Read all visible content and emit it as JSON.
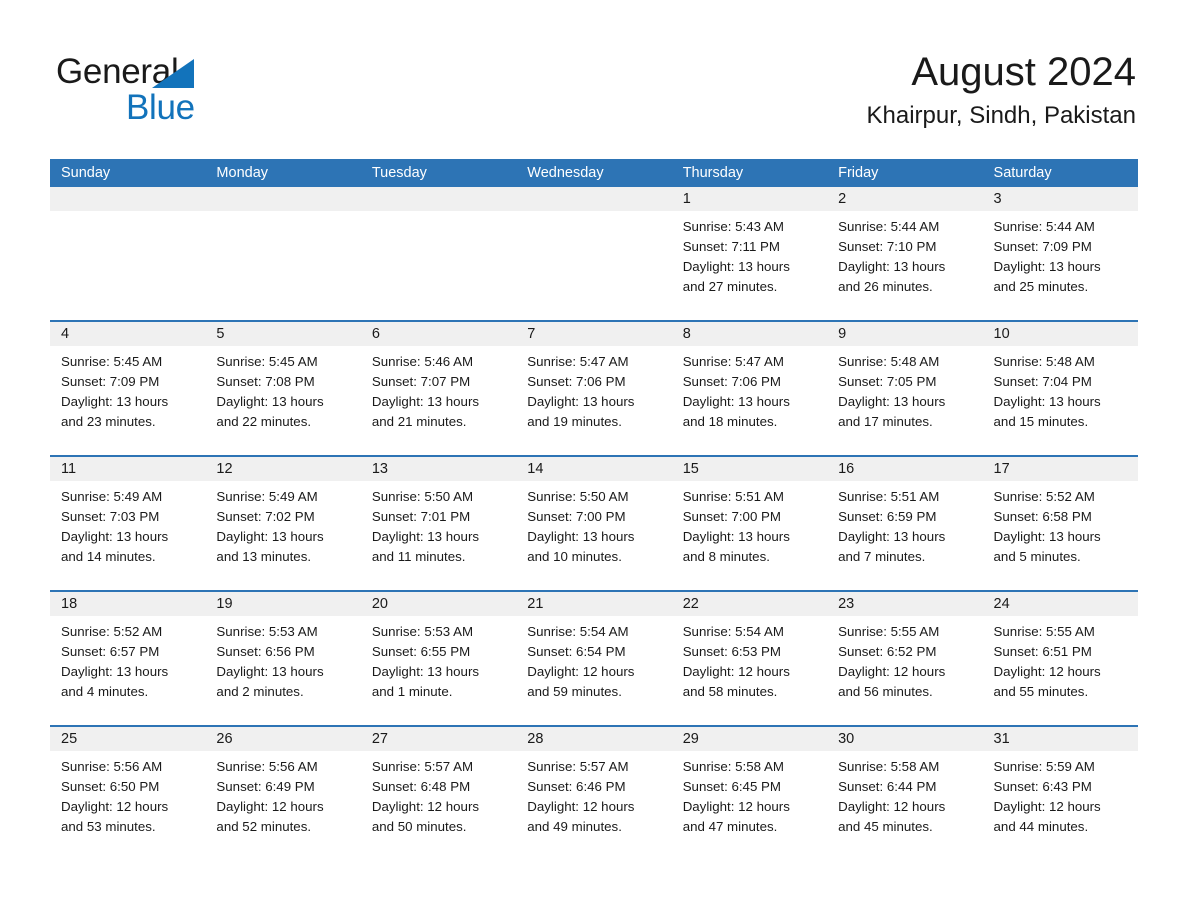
{
  "brand": {
    "name_part1": "General",
    "name_part2": "Blue",
    "logo_icon": "triangle-logo-icon",
    "colors": {
      "black": "#1a1a1a",
      "blue": "#1273bb"
    }
  },
  "header": {
    "title": "August 2024",
    "location": "Khairpur, Sindh, Pakistan"
  },
  "calendar": {
    "header_bg": "#2d74b5",
    "day_band_bg": "#f0f0f0",
    "weekdays": [
      "Sunday",
      "Monday",
      "Tuesday",
      "Wednesday",
      "Thursday",
      "Friday",
      "Saturday"
    ],
    "weeks": [
      [
        {
          "empty": true
        },
        {
          "empty": true
        },
        {
          "empty": true
        },
        {
          "empty": true
        },
        {
          "day": "1",
          "sunrise": "Sunrise: 5:43 AM",
          "sunset": "Sunset: 7:11 PM",
          "daylight_line1": "Daylight: 13 hours",
          "daylight_line2": "and 27 minutes."
        },
        {
          "day": "2",
          "sunrise": "Sunrise: 5:44 AM",
          "sunset": "Sunset: 7:10 PM",
          "daylight_line1": "Daylight: 13 hours",
          "daylight_line2": "and 26 minutes."
        },
        {
          "day": "3",
          "sunrise": "Sunrise: 5:44 AM",
          "sunset": "Sunset: 7:09 PM",
          "daylight_line1": "Daylight: 13 hours",
          "daylight_line2": "and 25 minutes."
        }
      ],
      [
        {
          "day": "4",
          "sunrise": "Sunrise: 5:45 AM",
          "sunset": "Sunset: 7:09 PM",
          "daylight_line1": "Daylight: 13 hours",
          "daylight_line2": "and 23 minutes."
        },
        {
          "day": "5",
          "sunrise": "Sunrise: 5:45 AM",
          "sunset": "Sunset: 7:08 PM",
          "daylight_line1": "Daylight: 13 hours",
          "daylight_line2": "and 22 minutes."
        },
        {
          "day": "6",
          "sunrise": "Sunrise: 5:46 AM",
          "sunset": "Sunset: 7:07 PM",
          "daylight_line1": "Daylight: 13 hours",
          "daylight_line2": "and 21 minutes."
        },
        {
          "day": "7",
          "sunrise": "Sunrise: 5:47 AM",
          "sunset": "Sunset: 7:06 PM",
          "daylight_line1": "Daylight: 13 hours",
          "daylight_line2": "and 19 minutes."
        },
        {
          "day": "8",
          "sunrise": "Sunrise: 5:47 AM",
          "sunset": "Sunset: 7:06 PM",
          "daylight_line1": "Daylight: 13 hours",
          "daylight_line2": "and 18 minutes."
        },
        {
          "day": "9",
          "sunrise": "Sunrise: 5:48 AM",
          "sunset": "Sunset: 7:05 PM",
          "daylight_line1": "Daylight: 13 hours",
          "daylight_line2": "and 17 minutes."
        },
        {
          "day": "10",
          "sunrise": "Sunrise: 5:48 AM",
          "sunset": "Sunset: 7:04 PM",
          "daylight_line1": "Daylight: 13 hours",
          "daylight_line2": "and 15 minutes."
        }
      ],
      [
        {
          "day": "11",
          "sunrise": "Sunrise: 5:49 AM",
          "sunset": "Sunset: 7:03 PM",
          "daylight_line1": "Daylight: 13 hours",
          "daylight_line2": "and 14 minutes."
        },
        {
          "day": "12",
          "sunrise": "Sunrise: 5:49 AM",
          "sunset": "Sunset: 7:02 PM",
          "daylight_line1": "Daylight: 13 hours",
          "daylight_line2": "and 13 minutes."
        },
        {
          "day": "13",
          "sunrise": "Sunrise: 5:50 AM",
          "sunset": "Sunset: 7:01 PM",
          "daylight_line1": "Daylight: 13 hours",
          "daylight_line2": "and 11 minutes."
        },
        {
          "day": "14",
          "sunrise": "Sunrise: 5:50 AM",
          "sunset": "Sunset: 7:00 PM",
          "daylight_line1": "Daylight: 13 hours",
          "daylight_line2": "and 10 minutes."
        },
        {
          "day": "15",
          "sunrise": "Sunrise: 5:51 AM",
          "sunset": "Sunset: 7:00 PM",
          "daylight_line1": "Daylight: 13 hours",
          "daylight_line2": "and 8 minutes."
        },
        {
          "day": "16",
          "sunrise": "Sunrise: 5:51 AM",
          "sunset": "Sunset: 6:59 PM",
          "daylight_line1": "Daylight: 13 hours",
          "daylight_line2": "and 7 minutes."
        },
        {
          "day": "17",
          "sunrise": "Sunrise: 5:52 AM",
          "sunset": "Sunset: 6:58 PM",
          "daylight_line1": "Daylight: 13 hours",
          "daylight_line2": "and 5 minutes."
        }
      ],
      [
        {
          "day": "18",
          "sunrise": "Sunrise: 5:52 AM",
          "sunset": "Sunset: 6:57 PM",
          "daylight_line1": "Daylight: 13 hours",
          "daylight_line2": "and 4 minutes."
        },
        {
          "day": "19",
          "sunrise": "Sunrise: 5:53 AM",
          "sunset": "Sunset: 6:56 PM",
          "daylight_line1": "Daylight: 13 hours",
          "daylight_line2": "and 2 minutes."
        },
        {
          "day": "20",
          "sunrise": "Sunrise: 5:53 AM",
          "sunset": "Sunset: 6:55 PM",
          "daylight_line1": "Daylight: 13 hours",
          "daylight_line2": "and 1 minute."
        },
        {
          "day": "21",
          "sunrise": "Sunrise: 5:54 AM",
          "sunset": "Sunset: 6:54 PM",
          "daylight_line1": "Daylight: 12 hours",
          "daylight_line2": "and 59 minutes."
        },
        {
          "day": "22",
          "sunrise": "Sunrise: 5:54 AM",
          "sunset": "Sunset: 6:53 PM",
          "daylight_line1": "Daylight: 12 hours",
          "daylight_line2": "and 58 minutes."
        },
        {
          "day": "23",
          "sunrise": "Sunrise: 5:55 AM",
          "sunset": "Sunset: 6:52 PM",
          "daylight_line1": "Daylight: 12 hours",
          "daylight_line2": "and 56 minutes."
        },
        {
          "day": "24",
          "sunrise": "Sunrise: 5:55 AM",
          "sunset": "Sunset: 6:51 PM",
          "daylight_line1": "Daylight: 12 hours",
          "daylight_line2": "and 55 minutes."
        }
      ],
      [
        {
          "day": "25",
          "sunrise": "Sunrise: 5:56 AM",
          "sunset": "Sunset: 6:50 PM",
          "daylight_line1": "Daylight: 12 hours",
          "daylight_line2": "and 53 minutes."
        },
        {
          "day": "26",
          "sunrise": "Sunrise: 5:56 AM",
          "sunset": "Sunset: 6:49 PM",
          "daylight_line1": "Daylight: 12 hours",
          "daylight_line2": "and 52 minutes."
        },
        {
          "day": "27",
          "sunrise": "Sunrise: 5:57 AM",
          "sunset": "Sunset: 6:48 PM",
          "daylight_line1": "Daylight: 12 hours",
          "daylight_line2": "and 50 minutes."
        },
        {
          "day": "28",
          "sunrise": "Sunrise: 5:57 AM",
          "sunset": "Sunset: 6:46 PM",
          "daylight_line1": "Daylight: 12 hours",
          "daylight_line2": "and 49 minutes."
        },
        {
          "day": "29",
          "sunrise": "Sunrise: 5:58 AM",
          "sunset": "Sunset: 6:45 PM",
          "daylight_line1": "Daylight: 12 hours",
          "daylight_line2": "and 47 minutes."
        },
        {
          "day": "30",
          "sunrise": "Sunrise: 5:58 AM",
          "sunset": "Sunset: 6:44 PM",
          "daylight_line1": "Daylight: 12 hours",
          "daylight_line2": "and 45 minutes."
        },
        {
          "day": "31",
          "sunrise": "Sunrise: 5:59 AM",
          "sunset": "Sunset: 6:43 PM",
          "daylight_line1": "Daylight: 12 hours",
          "daylight_line2": "and 44 minutes."
        }
      ]
    ]
  }
}
